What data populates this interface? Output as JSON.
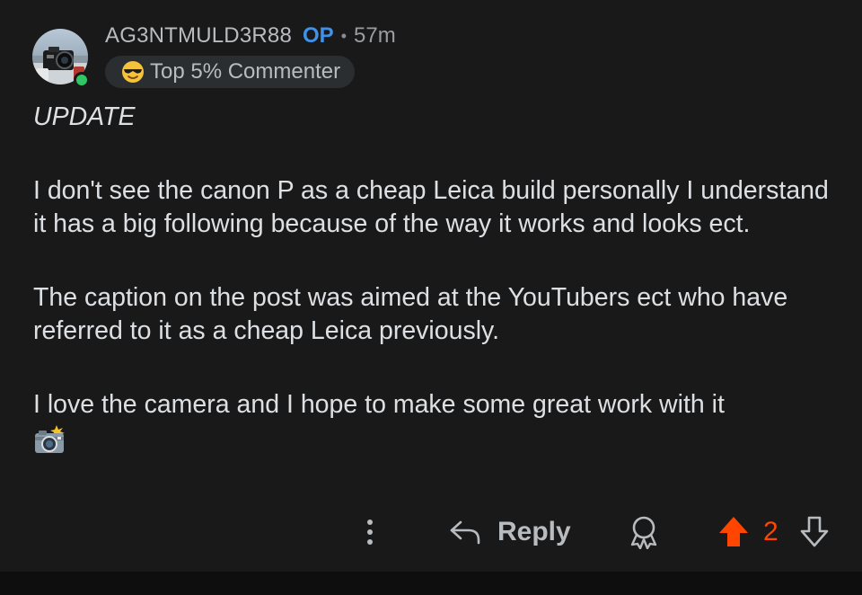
{
  "comment": {
    "username": "AG3NTMULD3R88",
    "op_tag": "OP",
    "separator": "•",
    "age": "57m",
    "badge": {
      "emoji_icon": "sunglasses-face-icon",
      "label": "Top 5% Commenter"
    },
    "body": {
      "heading": "UPDATE",
      "paragraphs": [
        "I don't see the canon P as a cheap Leica build personally I understand it has a big following because of the way it works and looks ect.",
        "The caption on the post was aimed at the YouTubers ect who have referred to it as a cheap Leica previously.",
        "I love the camera and I hope to make some great work with it"
      ],
      "trailing_emoji_icon": "camera-with-flash-icon"
    }
  },
  "actions": {
    "more_icon": "more-vertical-icon",
    "reply_label": "Reply",
    "award_icon": "award-icon",
    "score": "2"
  },
  "colors": {
    "background": "#19191a",
    "op": "#3d93ea",
    "upvote": "#ff4500",
    "online": "#2ec763"
  }
}
